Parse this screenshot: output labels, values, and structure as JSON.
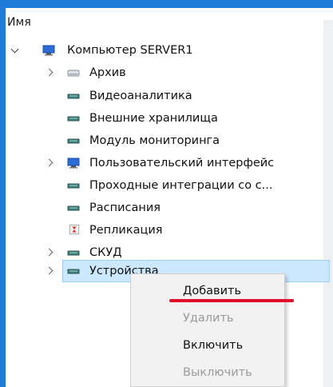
{
  "header": {
    "column_name": "Имя"
  },
  "tree": {
    "root": {
      "label": "Компьютер SERVER1",
      "icon": "monitor-icon"
    },
    "items": [
      {
        "label": "Архив",
        "icon": "drive-icon",
        "expandable": true
      },
      {
        "label": "Видеоаналитика",
        "icon": "server-icon",
        "expandable": false
      },
      {
        "label": "Внешние хранилища",
        "icon": "server-icon",
        "expandable": false
      },
      {
        "label": "Модуль мониторинга",
        "icon": "server-icon",
        "expandable": false
      },
      {
        "label": "Пользовательский интерфейс",
        "icon": "monitor-icon",
        "expandable": true
      },
      {
        "label": "Проходные интеграции со с...",
        "icon": "server-icon",
        "expandable": false
      },
      {
        "label": "Расписания",
        "icon": "server-icon",
        "expandable": false
      },
      {
        "label": "Репликация",
        "icon": "replication-icon",
        "expandable": false
      },
      {
        "label": "СКУД",
        "icon": "server-icon",
        "expandable": true
      },
      {
        "label": "Устройства",
        "icon": "server-icon",
        "expandable": true,
        "selected": true
      }
    ]
  },
  "context_menu": {
    "items": [
      {
        "label": "Добавить",
        "enabled": true,
        "highlighted": true
      },
      {
        "label": "Удалить",
        "enabled": false
      },
      {
        "label": "Включить",
        "enabled": true
      },
      {
        "label": "Выключить",
        "enabled": false
      }
    ]
  },
  "colors": {
    "window_border": "#1e7bd7",
    "selection_bg": "#cce8ff",
    "highlight_underline": "#e0112b"
  }
}
